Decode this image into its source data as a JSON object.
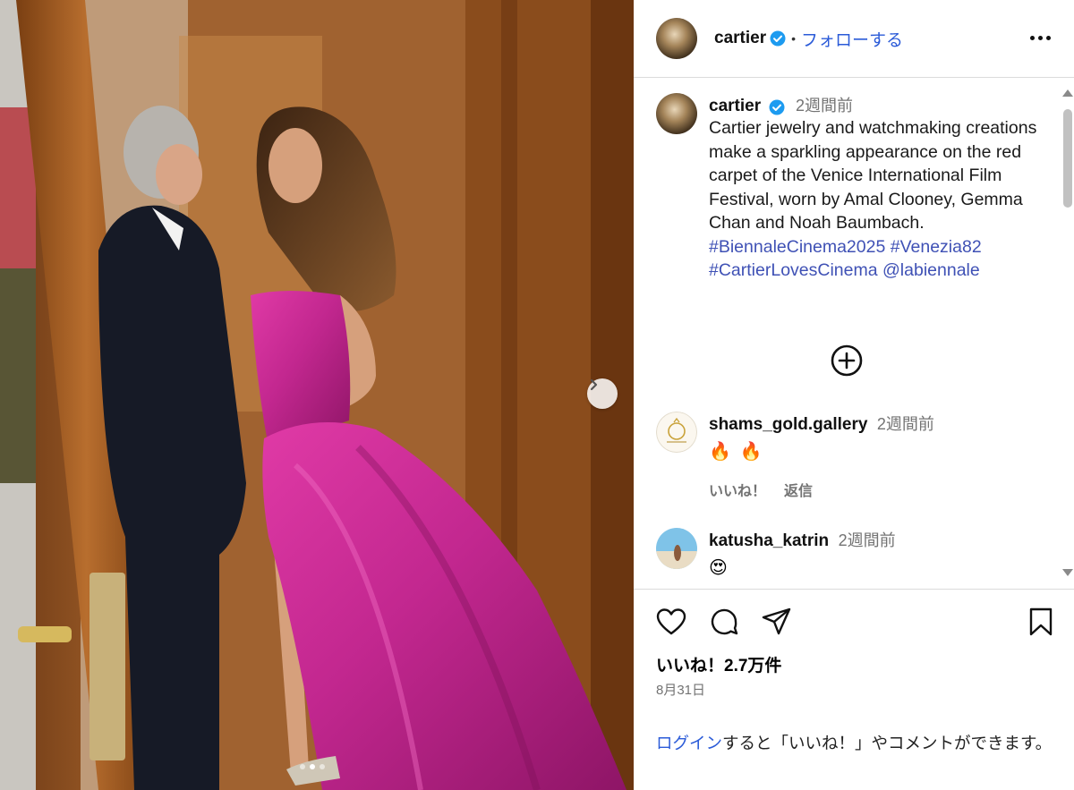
{
  "post": {
    "username": "cartier",
    "follow_label": "フォローする",
    "separator": "•",
    "caption": {
      "time": "2週間前",
      "text": "Cartier jewelry and watchmaking creations make a sparkling appearance on the red carpet of the Venice International Film Festival, worn by Amal Clooney, Gemma Chan and Noah Baumbach.",
      "tags": [
        "#BiennaleCinema2025",
        "#Venezia82",
        "#CartierLovesCinema",
        "@labiennale"
      ]
    },
    "comments": [
      {
        "username": "shams_gold.gallery",
        "time": "2週間前",
        "emoji": [
          "🔥",
          "🔥"
        ],
        "like_label": "いいね！",
        "reply_label": "返信"
      },
      {
        "username": "katusha_katrin",
        "time": "2週間前",
        "emoji": [
          "😍"
        ]
      }
    ],
    "likes": "いいね！2.7万件",
    "date": "8月31日",
    "login_note": {
      "link": "ログイン",
      "rest": "すると「いいね！」やコメントができます。"
    }
  },
  "colors": {
    "accent_link": "#2b5bd8",
    "hashtag": "#3f51b5",
    "verified_badge": "#1d9bf0",
    "muted_text": "#737373",
    "dress": "#c2278f"
  },
  "icons": [
    "verified-badge-icon",
    "more-options-icon",
    "plus-circle-icon",
    "heart-icon",
    "comment-icon",
    "share-icon",
    "bookmark-icon",
    "chevron-right-icon"
  ],
  "carousel": {
    "dots": 3,
    "active_dot": 1
  }
}
